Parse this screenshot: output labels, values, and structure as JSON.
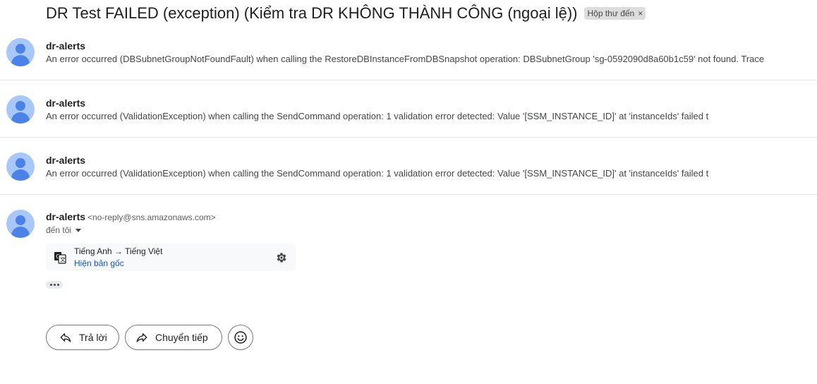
{
  "thread": {
    "subject": "DR Test FAILED (exception) (Kiểm tra DR KHÔNG THÀNH CÔNG (ngoại lệ))",
    "label": "Hộp thư đến",
    "label_close": "×"
  },
  "messages": [
    {
      "sender": "dr-alerts",
      "snippet": "An error occurred (DBSubnetGroupNotFoundFault) when calling the RestoreDBInstanceFromDBSnapshot operation: DBSubnetGroup 'sg-0592090d8a60b1c59' not found. Trace"
    },
    {
      "sender": "dr-alerts",
      "snippet": "An error occurred (ValidationException) when calling the SendCommand operation: 1 validation error detected: Value '[SSM_INSTANCE_ID]' at 'instanceIds' failed t"
    },
    {
      "sender": "dr-alerts",
      "snippet": "An error occurred (ValidationException) when calling the SendCommand operation: 1 validation error detected: Value '[SSM_INSTANCE_ID]' at 'instanceIds' failed t"
    }
  ],
  "open_message": {
    "sender": "dr-alerts",
    "email": "<no-reply@sns.amazonaws.com>",
    "to": "đến tôi",
    "translation": {
      "languages": "Tiếng Anh → Tiếng Việt",
      "show_original": "Hiện bản gốc"
    }
  },
  "actions": {
    "reply": "Trả lời",
    "forward": "Chuyển tiếp"
  },
  "icons": {
    "avatar": "person-avatar-icon",
    "translate": "translate-icon",
    "settings": "gear-icon",
    "reply": "reply-arrow-icon",
    "forward": "forward-arrow-icon",
    "emoji": "smiley-icon",
    "more": "ellipsis-icon"
  },
  "colors": {
    "link": "#0b57d0",
    "avatar_bg": "#a8c7fa",
    "avatar_fg": "#4a82e8",
    "label_bg": "#dddddd"
  }
}
